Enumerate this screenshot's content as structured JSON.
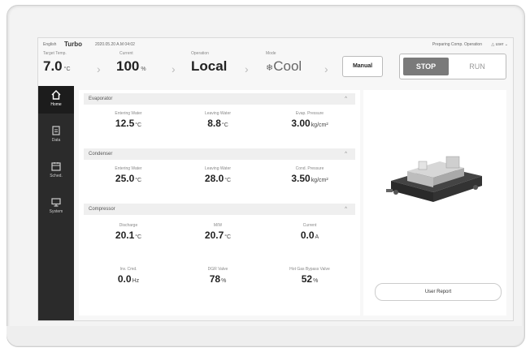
{
  "topbar": {
    "language": "English",
    "brand": "Turbo",
    "datetime": "2020.05.20 A.M 04:02",
    "status": "Preparing Comp. Operation",
    "user": "user"
  },
  "header": {
    "target_temp": {
      "label": "Target Temp.",
      "value": "7.0",
      "unit": "°C"
    },
    "current": {
      "label": "Current",
      "value": "100",
      "unit": "%"
    },
    "operation": {
      "label": "Operation",
      "value": "Local"
    },
    "mode": {
      "label": "Mode",
      "value": "Cool"
    },
    "manual_label": "Manual",
    "stop_label": "STOP",
    "run_label": "RUN"
  },
  "sidebar": {
    "items": [
      {
        "label": "Home",
        "icon": "home-icon",
        "active": true
      },
      {
        "label": "Data",
        "icon": "document-icon",
        "active": false
      },
      {
        "label": "Sched.",
        "icon": "calendar-icon",
        "active": false
      },
      {
        "label": "System",
        "icon": "monitor-icon",
        "active": false
      }
    ]
  },
  "evaporator": {
    "title": "Evaporator",
    "entering": {
      "label": "Entering Water",
      "value": "12.5",
      "unit": "°C"
    },
    "leaving": {
      "label": "Leaving Water",
      "value": "8.8",
      "unit": "°C"
    },
    "pressure": {
      "label": "Evap. Pressure",
      "value": "3.00",
      "unit": "kg/cm²"
    }
  },
  "condenser": {
    "title": "Condenser",
    "entering": {
      "label": "Entering Water",
      "value": "25.0",
      "unit": "°C"
    },
    "leaving": {
      "label": "Leaving Water",
      "value": "28.0",
      "unit": "°C"
    },
    "pressure": {
      "label": "Cond. Pressure",
      "value": "3.50",
      "unit": "kg/cm²"
    }
  },
  "compressor": {
    "title": "Compressor",
    "discharge": {
      "label": "Discharge",
      "value": "20.1",
      "unit": "°C"
    },
    "mw": {
      "label": "M/W",
      "value": "20.7",
      "unit": "°C"
    },
    "current": {
      "label": "Current",
      "value": "0.0",
      "unit": "A"
    },
    "inv_cmd": {
      "label": "Inv. Cmd.",
      "value": "0.0",
      "unit": "Hz"
    },
    "dgr_valve": {
      "label": "DGR Valve",
      "value": "78",
      "unit": "%"
    },
    "hot_gas": {
      "label": "Hot Gas Bypass Valve",
      "value": "52",
      "unit": "%"
    }
  },
  "right_panel": {
    "report_label": "User Report"
  }
}
